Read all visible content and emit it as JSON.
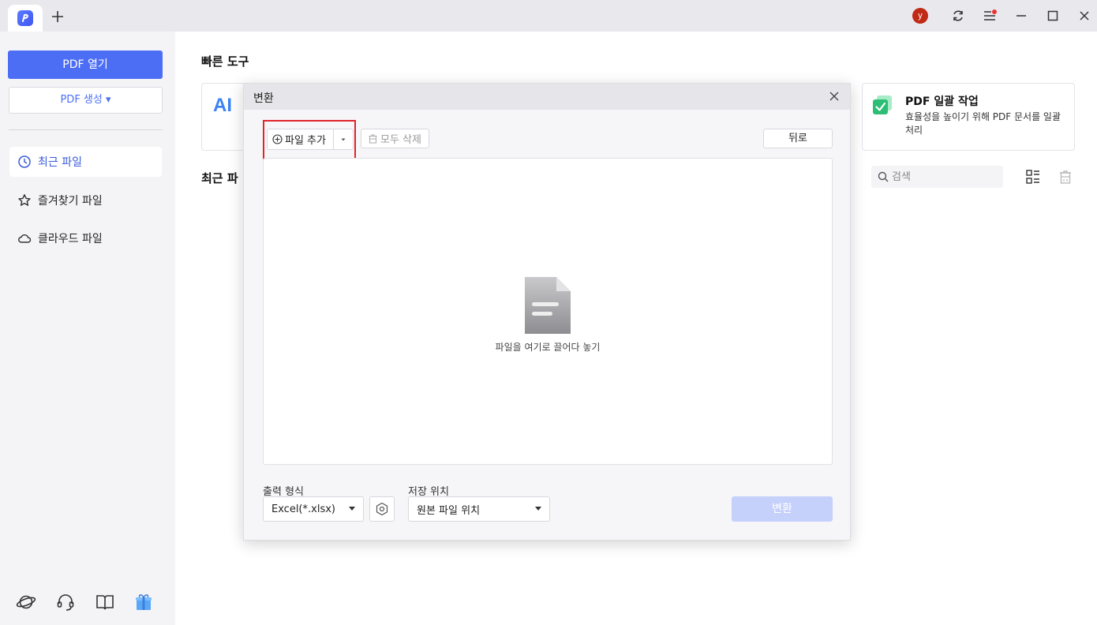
{
  "titlebar": {
    "avatar_initial": "y"
  },
  "sidebar": {
    "open_pdf": "PDF 열기",
    "create_pdf": "PDF 생성 ▾",
    "items": [
      {
        "label": "최근 파일"
      },
      {
        "label": "즐겨찾기 파일"
      },
      {
        "label": "클라우드 파일"
      }
    ]
  },
  "main": {
    "quick_tools_title": "빠른 도구",
    "ai_card_label": "AI",
    "batch_card": {
      "title": "PDF 일괄 작업",
      "description": "효율성을 높이기 위해 PDF 문서를 일괄 처리"
    },
    "recent_title": "최근 파",
    "search_placeholder": "검색"
  },
  "modal": {
    "title": "변환",
    "add_file": "파일 추가",
    "delete_all": "모두 삭제",
    "back": "뒤로",
    "drop_text": "파일을 여기로 끌어다 놓기",
    "output_format_label": "출력 형식",
    "output_format_value": "Excel(*.xlsx)",
    "save_location_label": "저장 위치",
    "save_location_value": "원본 파일 위치",
    "convert": "변환"
  },
  "colors": {
    "accent": "#4c6ef5",
    "highlight": "#e0242b",
    "convert_disabled": "#c5d0fb"
  }
}
